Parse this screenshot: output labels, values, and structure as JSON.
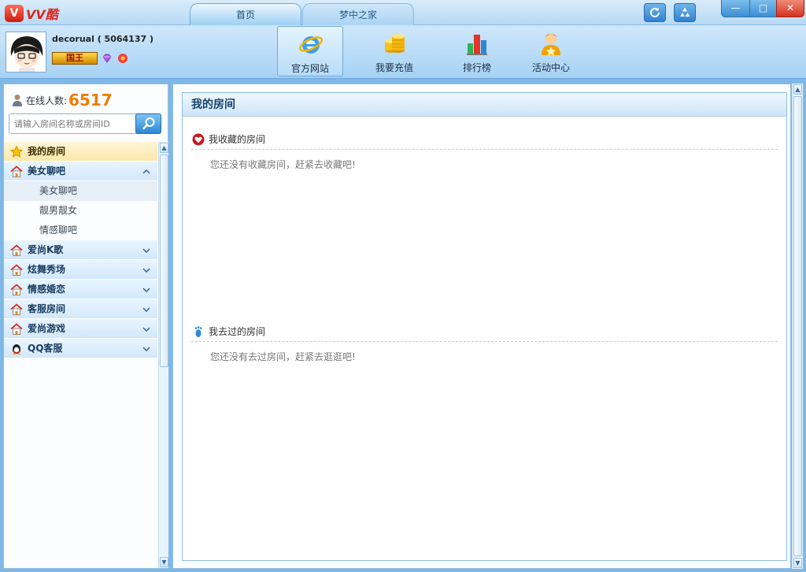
{
  "app": {
    "logo_mark": "V",
    "logo_text": "VV酷"
  },
  "tabs": [
    {
      "label": "首页",
      "active": true
    },
    {
      "label": "梦中之家",
      "active": false
    }
  ],
  "title_buttons": {
    "refresh_icon": "refresh-icon",
    "recycle_icon": "recycle-icon"
  },
  "window_controls": {
    "minimize": "—",
    "maximize": "□",
    "close": "✕"
  },
  "user": {
    "name_line": "decorual ( 5064137 )",
    "badge_label": "国王"
  },
  "toolbar": [
    {
      "label": "官方网站",
      "icon": "ie-browser-icon",
      "active": true
    },
    {
      "label": "我要充值",
      "icon": "coins-icon",
      "active": false
    },
    {
      "label": "排行榜",
      "icon": "bar-chart-icon",
      "active": false
    },
    {
      "label": "活动中心",
      "icon": "user-star-icon",
      "active": false
    }
  ],
  "sidebar": {
    "online_label": "在线人数:",
    "online_count": "6517",
    "search_placeholder": "请输入房间名称或房间ID",
    "nav": [
      {
        "label": "我的房间",
        "icon": "star-icon",
        "expanded": null
      },
      {
        "label": "美女聊吧",
        "icon": "house-icon",
        "expanded": true,
        "children": [
          {
            "label": "美女聊吧",
            "selected": true
          },
          {
            "label": "靓男靓女",
            "selected": false
          },
          {
            "label": "情感聊吧",
            "selected": false
          }
        ]
      },
      {
        "label": "爱尚K歌",
        "icon": "house-icon",
        "expanded": false
      },
      {
        "label": "炫舞秀场",
        "icon": "house-icon",
        "expanded": false
      },
      {
        "label": "情感婚恋",
        "icon": "house-icon",
        "expanded": false
      },
      {
        "label": "客服房间",
        "icon": "house-icon",
        "expanded": false
      },
      {
        "label": "爱尚游戏",
        "icon": "house-icon",
        "expanded": false
      },
      {
        "label": "QQ客服",
        "icon": "qq-penguin-icon",
        "expanded": false
      }
    ]
  },
  "main": {
    "title": "我的房间",
    "favorites": {
      "title": "我收藏的房间",
      "empty_text": "您还没有收藏房间，赶紧去收藏吧!"
    },
    "visited": {
      "title": "我去过的房间",
      "empty_text": "您还没有去过房间，赶紧去逛逛吧!"
    }
  },
  "colors": {
    "accent_orange": "#f07c00",
    "frame_blue": "#7fb8e6",
    "header_text": "#16416b"
  }
}
